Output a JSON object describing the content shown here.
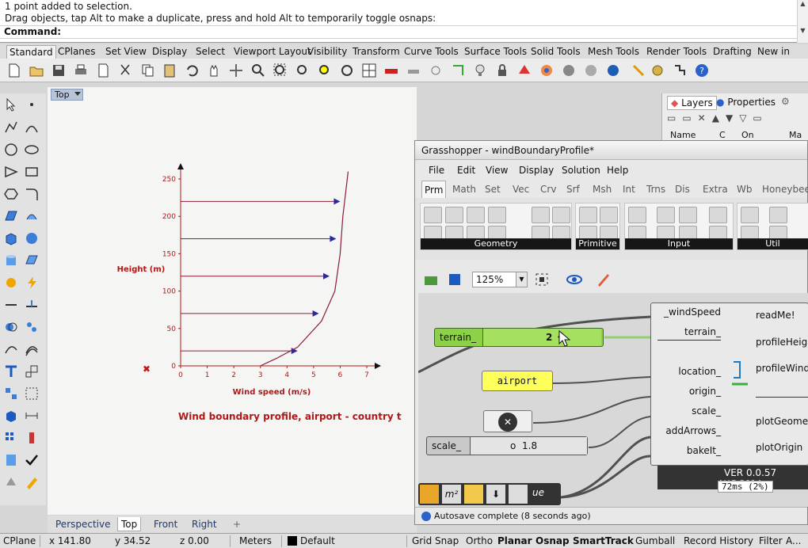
{
  "command": {
    "history": [
      "1 point added to selection.",
      "Drag objects, tap Alt to make a duplicate, press and hold Alt to temporarily toggle osnaps:"
    ],
    "prompt": "Command:"
  },
  "toolbar_tabs": [
    "Standard",
    "CPlanes",
    "Set View",
    "Display",
    "Select",
    "Viewport Layout",
    "Visibility",
    "Transform",
    "Curve Tools",
    "Surface Tools",
    "Solid Tools",
    "Mesh Tools",
    "Render Tools",
    "Drafting",
    "New in"
  ],
  "viewport": {
    "name": "Top",
    "chart_data": {
      "type": "line",
      "title": "Wind boundary profile, airport - country t",
      "xlabel": "Wind speed (m/s)",
      "ylabel": "Height (m)",
      "xlim": [
        0,
        7
      ],
      "ylim": [
        0,
        250
      ],
      "x_ticks": [
        "0",
        "1",
        "2",
        "3",
        "4",
        "5",
        "6",
        "7"
      ],
      "y_ticks": [
        "0",
        "50",
        "100",
        "150",
        "200",
        "250"
      ],
      "series": [
        {
          "points": [
            [
              3.0,
              0
            ],
            [
              3.6,
              10
            ],
            [
              4.4,
              25
            ],
            [
              5.3,
              60
            ],
            [
              5.8,
              100
            ],
            [
              6.0,
              150
            ],
            [
              6.1,
              200
            ],
            [
              6.3,
              260
            ]
          ]
        }
      ],
      "arrows": [
        {
          "height": 20,
          "speed": 4.4
        },
        {
          "height": 70,
          "speed": 5.2
        },
        {
          "height": 120,
          "speed": 5.6
        },
        {
          "height": 170,
          "speed": 5.85
        },
        {
          "height": 220,
          "speed": 6.0
        }
      ],
      "colors": {
        "axis": "#b01818",
        "arrows": "#2a2a9c",
        "curve": "#8c1c38"
      }
    }
  },
  "viewport_tabs": [
    "Perspective",
    "Top",
    "Front",
    "Right"
  ],
  "layers_panel": {
    "tabs": [
      "Layers",
      "Properties"
    ],
    "columns": [
      "Name",
      "C",
      "On",
      "Ma"
    ]
  },
  "grasshopper": {
    "title": "Grasshopper - windBoundaryProfile*",
    "menu": [
      "File",
      "Edit",
      "View",
      "Display",
      "Solution",
      "Help"
    ],
    "tabs": [
      "Prm",
      "Math",
      "Set",
      "Vec",
      "Crv",
      "Srf",
      "Msh",
      "Int",
      "Trns",
      "Dis",
      "Extra",
      "Wb",
      "Honeybee"
    ],
    "groups": [
      "Geometry",
      "Primitive",
      "Input",
      "Util"
    ],
    "zoom": "125%",
    "components": {
      "terrain_slider": {
        "label": "terrain_",
        "value": "2"
      },
      "airport_panel": "airport",
      "scale_slider": {
        "label": "scale_",
        "value": "1.8"
      },
      "inputs": [
        "_windSpeed",
        "terrain_",
        "location_",
        "origin_",
        "scale_",
        "addArrows_",
        "bakeIt_"
      ],
      "outputs": [
        "readMe!",
        "profileHeig",
        "profileWind",
        "plotGeome",
        "plotOrigin"
      ],
      "version": "VER 0.0.57",
      "version_sub": "AUG 2014",
      "timing": "72ms (2%)",
      "ribbon_label": "ue"
    },
    "status": "Autosave complete (8 seconds ago)"
  },
  "statusbar": {
    "cplane": "CPlane",
    "x": "x 141.80",
    "y": "y 34.52",
    "z": "z 0.00",
    "units": "Meters",
    "layer": "Default",
    "toggles": [
      {
        "label": "Grid Snap",
        "bold": false
      },
      {
        "label": "Ortho",
        "bold": false
      },
      {
        "label": "Planar",
        "bold": true
      },
      {
        "label": "Osnap",
        "bold": true
      },
      {
        "label": "SmartTrack",
        "bold": true
      },
      {
        "label": "Gumball",
        "bold": false
      },
      {
        "label": "Record History",
        "bold": false
      },
      {
        "label": "Filter",
        "bold": false
      },
      {
        "label": "A...",
        "bold": false
      }
    ]
  }
}
